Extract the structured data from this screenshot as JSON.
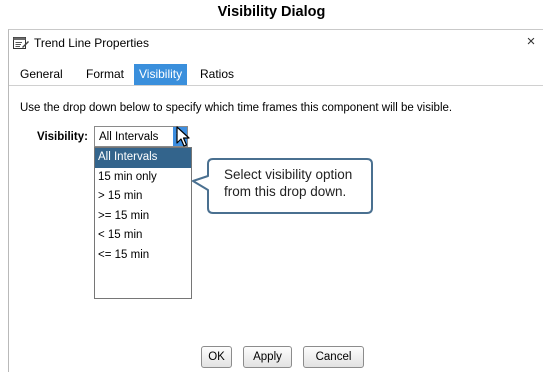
{
  "caption": "Visibility Dialog",
  "window": {
    "title": "Trend Line Properties",
    "close_glyph": "×"
  },
  "tabs": [
    {
      "label": "General"
    },
    {
      "label": "Format"
    },
    {
      "label": "Visibility",
      "active": true
    },
    {
      "label": "Ratios"
    }
  ],
  "description": "Use the drop down below to specify which time frames this component will be visible.",
  "visibility": {
    "label": "Visibility:",
    "selected": "All Intervals",
    "options": [
      "All Intervals",
      "15 min only",
      "> 15 min",
      ">= 15 min",
      "< 15 min",
      "<= 15 min"
    ]
  },
  "callout": {
    "line1": "Select visibility option",
    "line2": "from this drop down."
  },
  "buttons": {
    "ok": "OK",
    "apply": "Apply",
    "cancel": "Cancel"
  },
  "colors": {
    "accent": "#3a8fdc",
    "selected_option": "#33648c",
    "callout_border": "#4a7090"
  },
  "icons": {
    "title": "properties-icon",
    "dropdown": "dropdown-arrow-icon",
    "cursor": "mouse-pointer-icon"
  }
}
